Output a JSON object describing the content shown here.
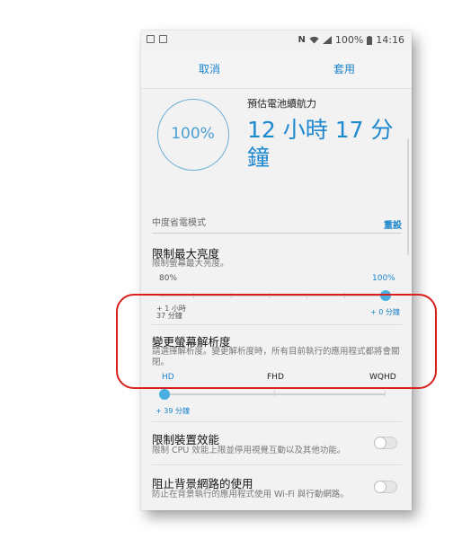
{
  "status_bar": {
    "right_text": "100%",
    "time": "14:16",
    "icons": [
      "gallery-icon",
      "photo-icon",
      "nfc-icon",
      "wifi-icon",
      "signal-icon",
      "battery-icon"
    ]
  },
  "action_bar": {
    "cancel_label": "取消",
    "apply_label": "套用"
  },
  "battery": {
    "percent_label": "100%",
    "estimate_label": "預估電池續航力",
    "estimate_value": "12 小時 17 分鐘"
  },
  "mode": {
    "title": "中度省電模式",
    "reset_label": "重設"
  },
  "brightness": {
    "title": "限制最大亮度",
    "desc": "限制螢幕最大亮度。",
    "min_label": "80%",
    "max_label": "100%",
    "min_note_line1": "+ 1 小時",
    "min_note_line2": "37 分鐘",
    "max_note": "+ 0 分鐘",
    "value_percent": 100
  },
  "resolution": {
    "title": "變更螢幕解析度",
    "desc": "請選擇解析度。變更解析度時，所有目前執行的應用程式都將會關閉。",
    "options": [
      "HD",
      "FHD",
      "WQHD"
    ],
    "selected": "HD",
    "note": "+ 39 分鐘"
  },
  "performance": {
    "title": "限制裝置效能",
    "desc": "限制 CPU 效能上限並停用視覺互動以及其他功能。",
    "enabled": false
  },
  "background_network": {
    "title": "阻止背景網路的使用",
    "desc": "防止在背景執行的應用程式使用 Wi-Fi 與行動網路。",
    "enabled": false
  },
  "colors": {
    "accent": "#1a84c9",
    "slider_thumb": "#4aaee0",
    "highlight_border": "#d8201e"
  }
}
